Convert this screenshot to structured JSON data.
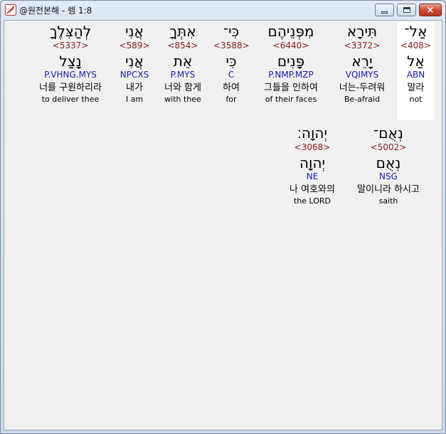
{
  "window": {
    "title": "@원전본해 - 렘 1:8",
    "icon": "app-feather-icon",
    "controls": {
      "minimize": "minimize-icon",
      "maximize": "maximize-icon",
      "close": "×"
    }
  },
  "words": [
    {
      "hebrew": "אַל־",
      "strong": "<408>",
      "lemma": "אַל",
      "morph": "ABN",
      "korean": "말라",
      "english": "not",
      "highlight": true
    },
    {
      "hebrew": "תִּירָא",
      "strong": "<3372>",
      "lemma": "יָרֵא",
      "morph": "VQIMYS",
      "korean": "너는-두려워",
      "english": "Be-afraid",
      "highlight": false
    },
    {
      "hebrew": "מִפְּנֵיהֶם",
      "strong": "<6440>",
      "lemma": "פָּנִים",
      "morph": "P.NMP.MZP",
      "korean": "그들을 인하여",
      "english": "of their faces",
      "highlight": false
    },
    {
      "hebrew": "כִּי־",
      "strong": "<3588>",
      "lemma": "כִּי",
      "morph": "C",
      "korean": "하여",
      "english": "for",
      "highlight": false
    },
    {
      "hebrew": "אִתְּךָ",
      "strong": "<854>",
      "lemma": "אֵת",
      "morph": "P.MYS",
      "korean": "너와 함게",
      "english": "with thee",
      "highlight": false
    },
    {
      "hebrew": "אֲנִי",
      "strong": "<589>",
      "lemma": "אֲנִי",
      "morph": "NPCXS",
      "korean": "내가",
      "english": "I am",
      "highlight": false
    },
    {
      "hebrew": "לְהַצִּלֶךָ",
      "strong": "<5337>",
      "lemma": "נָצַל",
      "morph": "P.VHNG.MYS",
      "korean": "너를 구원하리라",
      "english": "to deliver thee",
      "highlight": false
    },
    {
      "hebrew": "נְאֻם־",
      "strong": "<5002>",
      "lemma": "נְאֻם",
      "morph": "NSG",
      "korean": "말이니라 하시고",
      "english": "saith",
      "highlight": false
    },
    {
      "hebrew": "יְהוָה׃",
      "strong": "<3068>",
      "lemma": "יְהוָה",
      "morph": "NE",
      "korean": "나 여호와의",
      "english": "the LORD",
      "highlight": false
    }
  ]
}
